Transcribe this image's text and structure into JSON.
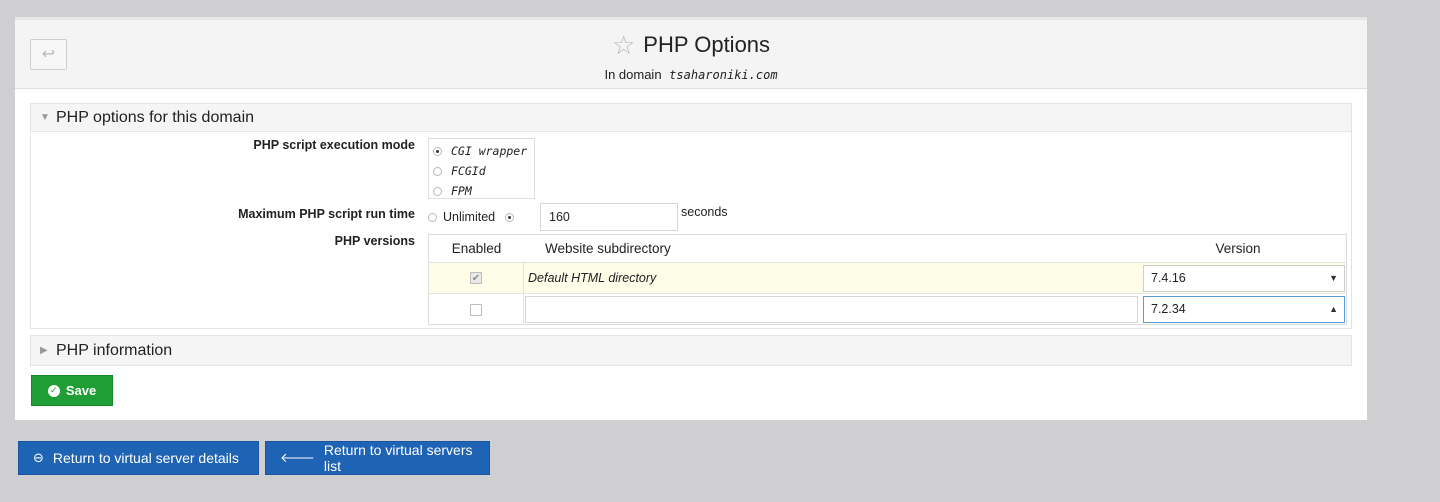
{
  "page": {
    "title": "PHP Options",
    "subtitle_prefix": "In domain",
    "domain": "tsaharoniki.com",
    "back_icon": "↩",
    "star_icon": "☆"
  },
  "section_options": {
    "heading": "PHP options for this domain",
    "exec_mode": {
      "label": "PHP script execution mode",
      "options": [
        "CGI wrapper",
        "FCGId",
        "FPM"
      ],
      "selected": "CGI wrapper"
    },
    "run_time": {
      "label": "Maximum PHP script run time",
      "unlimited_label": "Unlimited",
      "value": "160",
      "unit": "seconds",
      "selected": "value"
    },
    "versions": {
      "label": "PHP versions",
      "columns": [
        "Enabled",
        "Website subdirectory",
        "Version"
      ],
      "rows": [
        {
          "enabled": true,
          "subdirectory": "Default HTML directory",
          "version": "7.4.16"
        },
        {
          "enabled": false,
          "subdirectory": "",
          "version": "7.2.34"
        }
      ]
    }
  },
  "section_info": {
    "heading": "PHP information"
  },
  "buttons": {
    "save": "Save",
    "return_details": "Return to virtual server details",
    "return_list": "Return to virtual servers list"
  },
  "colors": {
    "save": "#1e9e34",
    "nav": "#1f64b4",
    "highlight_row": "#fdfde8"
  }
}
